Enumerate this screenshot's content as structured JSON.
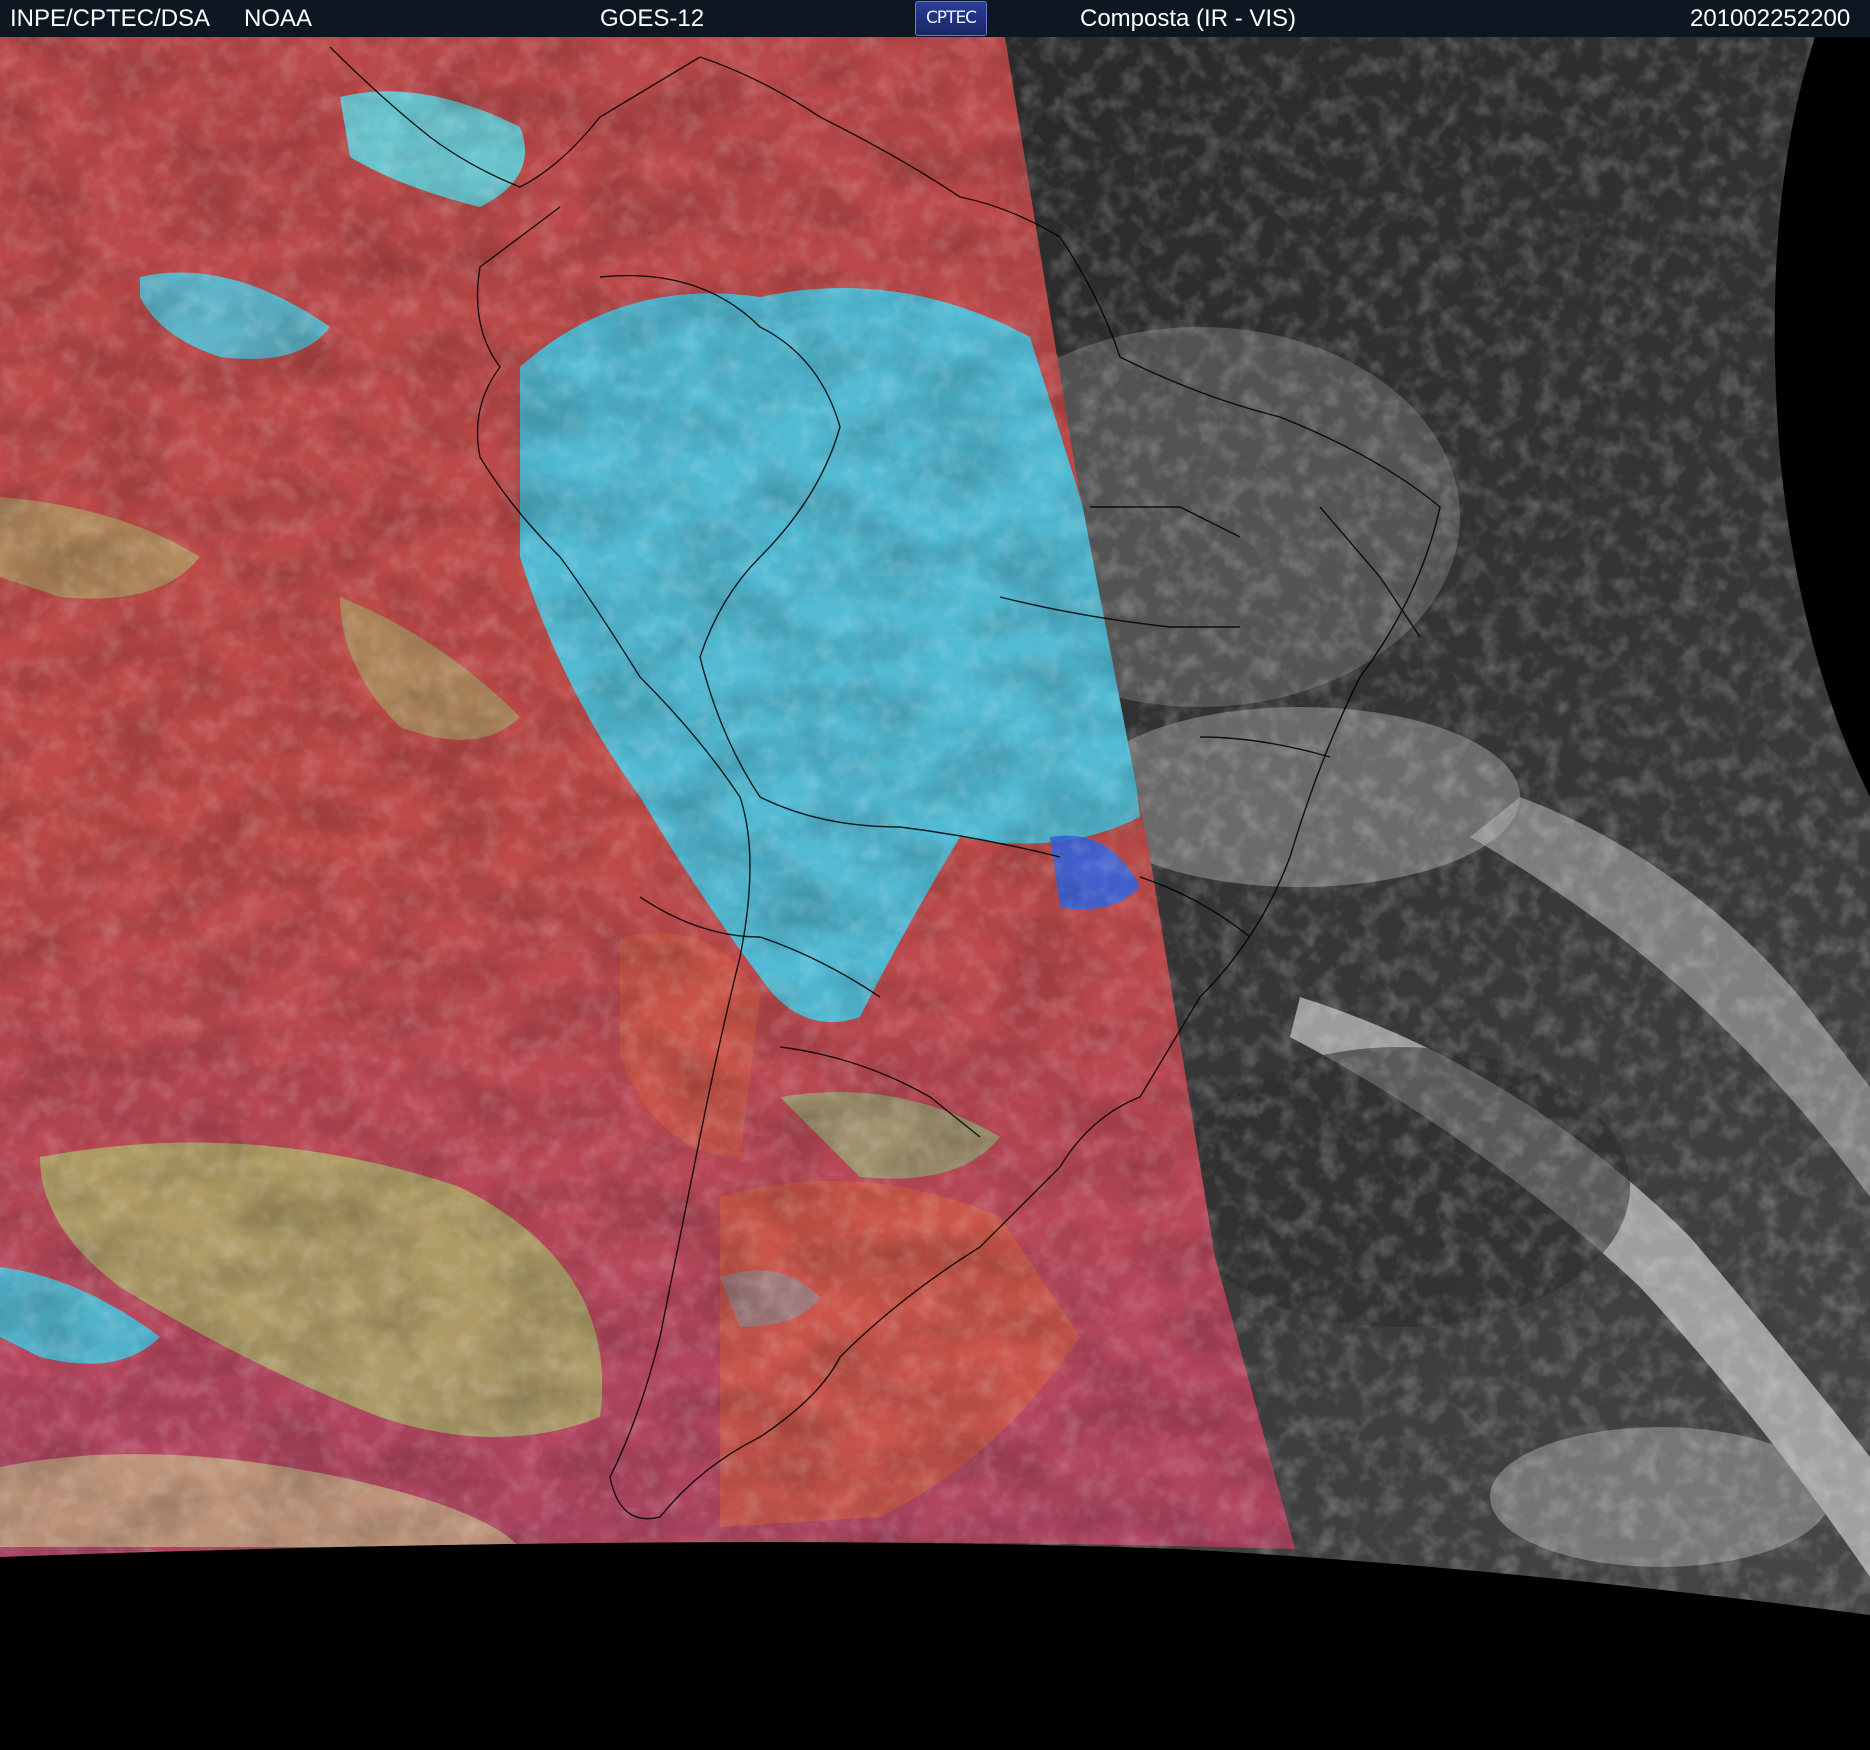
{
  "header": {
    "source": "INPE/CPTEC/DSA",
    "agency": "NOAA",
    "satellite": "GOES-12",
    "logo_text": "CPTEC",
    "product": "Composta (IR - VIS)",
    "timestamp": "201002252200"
  },
  "colors": {
    "header_bg": "#0c1722",
    "ir_ocean": "#b8424a",
    "ir_cloud_cyan": "#38d8f0",
    "ir_cloud_green": "#a8d070",
    "vis_ocean": "#2a2a2a",
    "vis_cloud": "#d8d8d8",
    "space": "#000000"
  }
}
